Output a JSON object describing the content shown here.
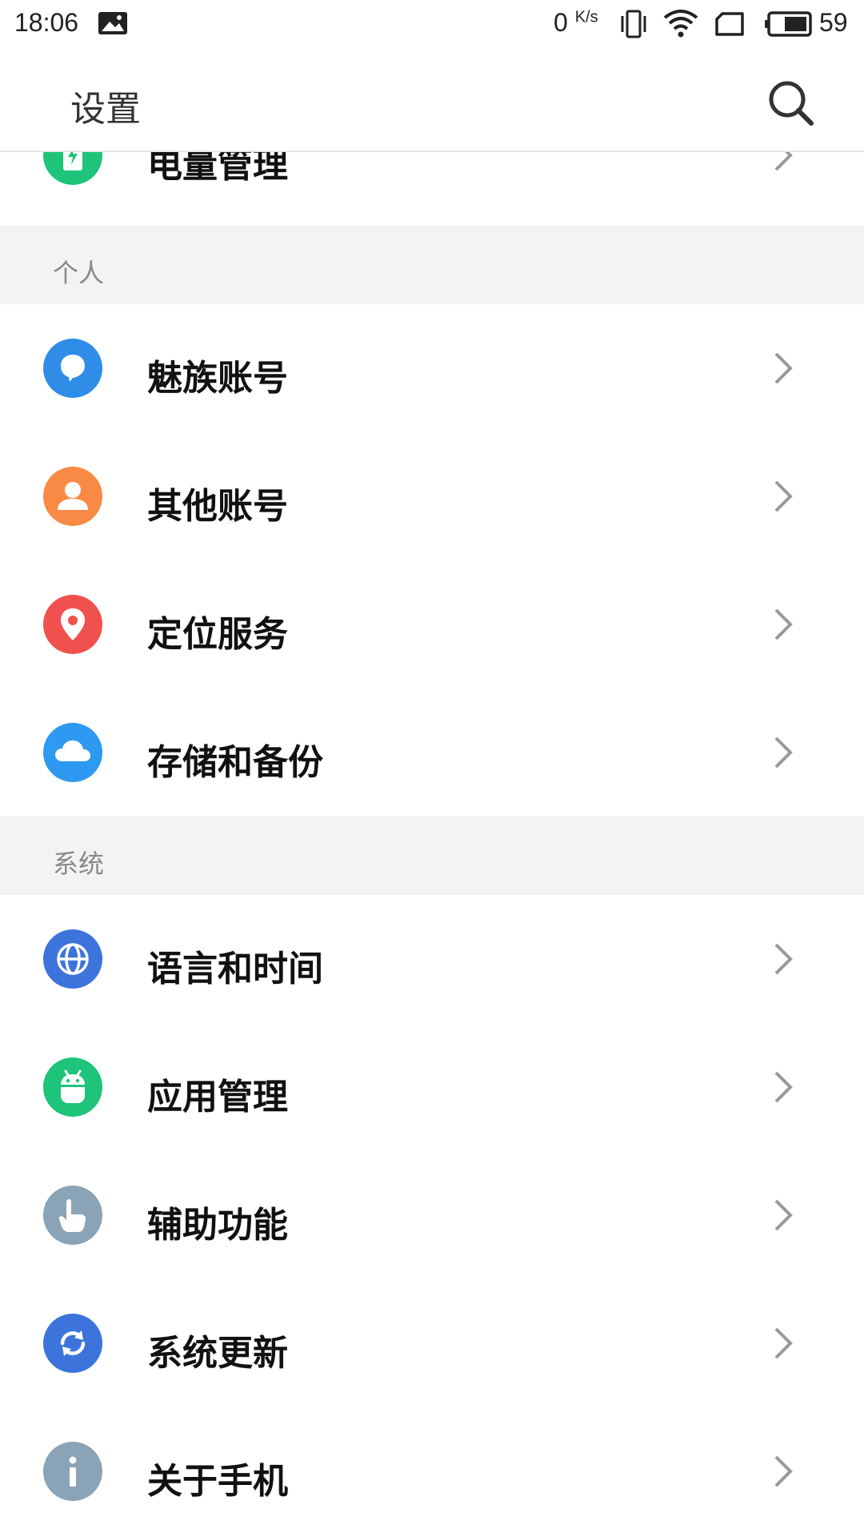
{
  "status_bar": {
    "time": "18:06",
    "speed_value": "0",
    "speed_unit": "K/s",
    "battery_percent": "59"
  },
  "header": {
    "title": "设置"
  },
  "top_partial_item": {
    "label": "电量管理",
    "color": "#1dc47a"
  },
  "sections": [
    {
      "title": "个人",
      "items": [
        {
          "label": "魅族账号",
          "icon": "balloon-icon",
          "color": "#2f8de8"
        },
        {
          "label": "其他账号",
          "icon": "person-icon",
          "color": "#f98a45"
        },
        {
          "label": "定位服务",
          "icon": "location-pin-icon",
          "color": "#f0514f"
        },
        {
          "label": "存储和备份",
          "icon": "cloud-icon",
          "color": "#2e99f1"
        }
      ]
    },
    {
      "title": "系统",
      "items": [
        {
          "label": "语言和时间",
          "icon": "globe-icon",
          "color": "#3c74dc"
        },
        {
          "label": "应用管理",
          "icon": "android-icon",
          "color": "#1dc47a"
        },
        {
          "label": "辅助功能",
          "icon": "hand-pointer-icon",
          "color": "#8aa3b6"
        },
        {
          "label": "系统更新",
          "icon": "refresh-icon",
          "color": "#3c74dc"
        },
        {
          "label": "关于手机",
          "icon": "info-icon",
          "color": "#8aa3b6"
        }
      ]
    }
  ]
}
